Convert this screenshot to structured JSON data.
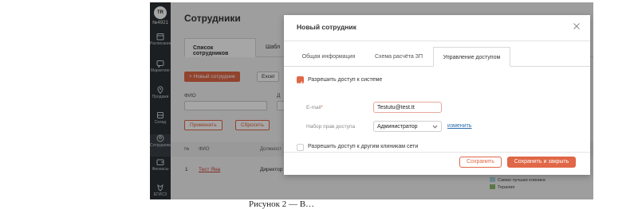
{
  "sidebar": {
    "logo": "TR",
    "clinic_number": "№4921",
    "items": [
      {
        "label": "Расписание",
        "icon": "calendar-icon"
      },
      {
        "label": "Маркетинг",
        "icon": "chat-icon"
      },
      {
        "label": "Продажи",
        "icon": "location-icon"
      },
      {
        "label": "Склад",
        "icon": "warehouse-icon"
      },
      {
        "label": "Сотрудники",
        "icon": "user-icon"
      },
      {
        "label": "Финансы",
        "icon": "wallet-icon"
      },
      {
        "label": "ЕГИСЗ",
        "icon": "emblem-icon"
      }
    ]
  },
  "main": {
    "title": "Сотрудники",
    "tabs": [
      {
        "label": "Список сотрудников"
      },
      {
        "label": "Шабл"
      }
    ],
    "new_button": "Новый сотрудник",
    "excel_button": "Excel",
    "filters": {
      "fio_label": "ФИО",
      "second_label": "Д",
      "apply": "Применить",
      "reset": "Сбросить"
    },
    "table": {
      "headers": [
        "№",
        "ФИО",
        "Должност"
      ],
      "rows": [
        {
          "num": "1",
          "name": "Тест Яна",
          "position": "Директор"
        }
      ]
    },
    "legend": [
      {
        "label": "Хирургия",
        "color": "#8fc3d9"
      },
      {
        "label": "Самая лучшая клиника",
        "color": "#a9d4e0"
      },
      {
        "label": "Терапия",
        "color": "#8bb86a"
      }
    ]
  },
  "dialog": {
    "title": "Новый сотрудник",
    "tabs": [
      {
        "label": "Общая информация"
      },
      {
        "label": "Схема расчёта ЗП"
      },
      {
        "label": "Управление доступом"
      }
    ],
    "allow_access_label": "Разрешить доступ к системе",
    "email_label": "E-mail",
    "required_mark": "*",
    "email_value": "Testutu@test.tt",
    "rights_label": "Набор прав доступа",
    "rights_value": "Администратор",
    "edit_link": "изменить",
    "allow_other_clinics_label": "Разрешить доступ к другим клиникам сети",
    "save_button": "Сохранить",
    "save_close_button": "Сохранить и закрыть"
  },
  "caption": "Рисунок 2 — В…",
  "colors": {
    "accent": "#e06747",
    "sidebar": "#2b3035"
  }
}
